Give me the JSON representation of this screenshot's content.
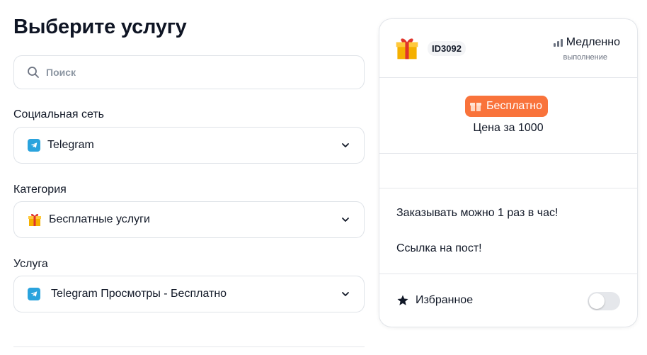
{
  "page": {
    "title": "Выберите услугу"
  },
  "search": {
    "placeholder": "Поиск",
    "value": ""
  },
  "fields": {
    "social": {
      "label": "Социальная сеть",
      "value": "Telegram",
      "icon": "telegram-icon"
    },
    "category": {
      "label": "Категория",
      "value": "Бесплатные услуги",
      "icon": "gift-icon"
    },
    "service": {
      "label": "Услуга",
      "value": "Telegram Просмотры - Бесплатно",
      "icon": "telegram-icon"
    }
  },
  "card": {
    "id": "ID3092",
    "speed": "Медленно",
    "speed_sub": "выполнение",
    "price_badge": "Бесплатно",
    "price_text": "Цена за 1000",
    "description": [
      "Заказывать можно 1 раз в час!",
      "Ссылка на пост!"
    ],
    "favorite_label": "Избранное",
    "favorite_on": false
  },
  "colors": {
    "accent_orange": "#f9733b",
    "telegram_blue": "#2aa3dd",
    "border": "#dfe3e8"
  }
}
